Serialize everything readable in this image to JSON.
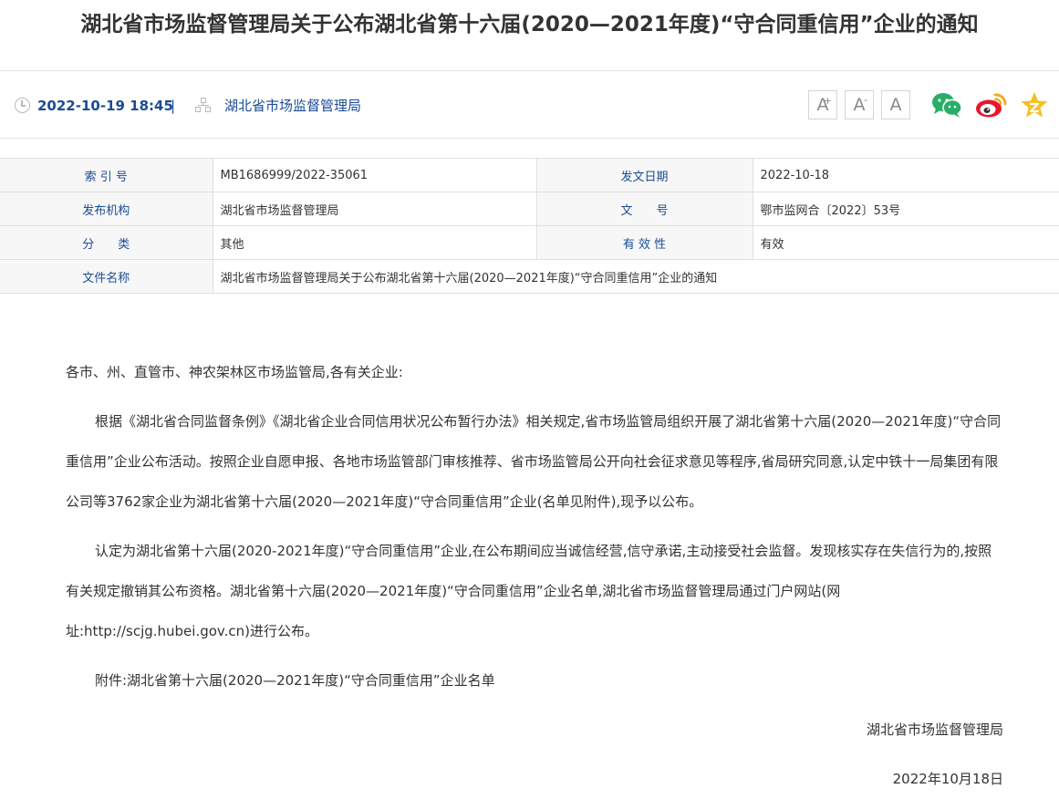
{
  "article": {
    "title": "湖北省市场监督管理局关于公布湖北省第十六届(2020—2021年度)“守合同重信用”企业的通知",
    "date": "2022-10-19 18:45",
    "separator": "|",
    "source": "湖北省市场监督管理局"
  },
  "toolbar": {
    "font_large": "A",
    "font_large_mark": "+",
    "font_small": "A",
    "font_small_mark": "-",
    "font_reset": "A",
    "icons": [
      "wechat-icon",
      "weibo-icon",
      "favorite-icon"
    ]
  },
  "info_table": {
    "index_label": "索 引 号",
    "index_value": "MB1686999/2022-35061",
    "pubdate_label": "发文日期",
    "pubdate_value": "2022-10-18",
    "issuer_label": "发布机构",
    "issuer_value": "湖北省市场监督管理局",
    "docno_label": "文　　号",
    "docno_value": "鄂市监网合〔2022〕53号",
    "category_label": "分　　类",
    "category_value": "其他",
    "validity_label": "有 效 性",
    "validity_value": "有效",
    "filename_label": "文件名称",
    "filename_value": "湖北省市场监督管理局关于公布湖北省第十六届(2020—2021年度)“守合同重信用”企业的通知"
  },
  "body": {
    "greeting": "各市、州、直管市、神农架林区市场监管局,各有关企业:",
    "para1": "根据《湖北省合同监督条例》《湖北省企业合同信用状况公布暂行办法》相关规定,省市场监管局组织开展了湖北省第十六届(2020—2021年度)“守合同重信用”企业公布活动。按照企业自愿申报、各地市场监管部门审核推荐、省市场监管局公开向社会征求意见等程序,省局研究同意,认定中铁十一局集团有限公司等3762家企业为湖北省第十六届(2020—2021年度)“守合同重信用”企业(名单见附件),现予以公布。",
    "para2": "认定为湖北省第十六届(2020-2021年度)“守合同重信用”企业,在公布期间应当诚信经营,信守承诺,主动接受社会监督。发现核实存在失信行为的,按照有关规定撤销其公布资格。湖北省第十六届(2020—2021年度)“守合同重信用”企业名单,湖北省市场监督管理局通过门户网站(网址:http://scjg.hubei.gov.cn)进行公布。",
    "attachment": "附件:湖北省第十六届(2020—2021年度)“守合同重信用”企业名单",
    "signature": "湖北省市场监督管理局",
    "sign_date": "2022年10月18日"
  },
  "colors": {
    "link_blue": "#1a4c95",
    "wechat_green": "#2aae67",
    "weibo_orange": "#f5a623",
    "weibo_red": "#e6162d",
    "star_yellow": "#f5c01c"
  }
}
